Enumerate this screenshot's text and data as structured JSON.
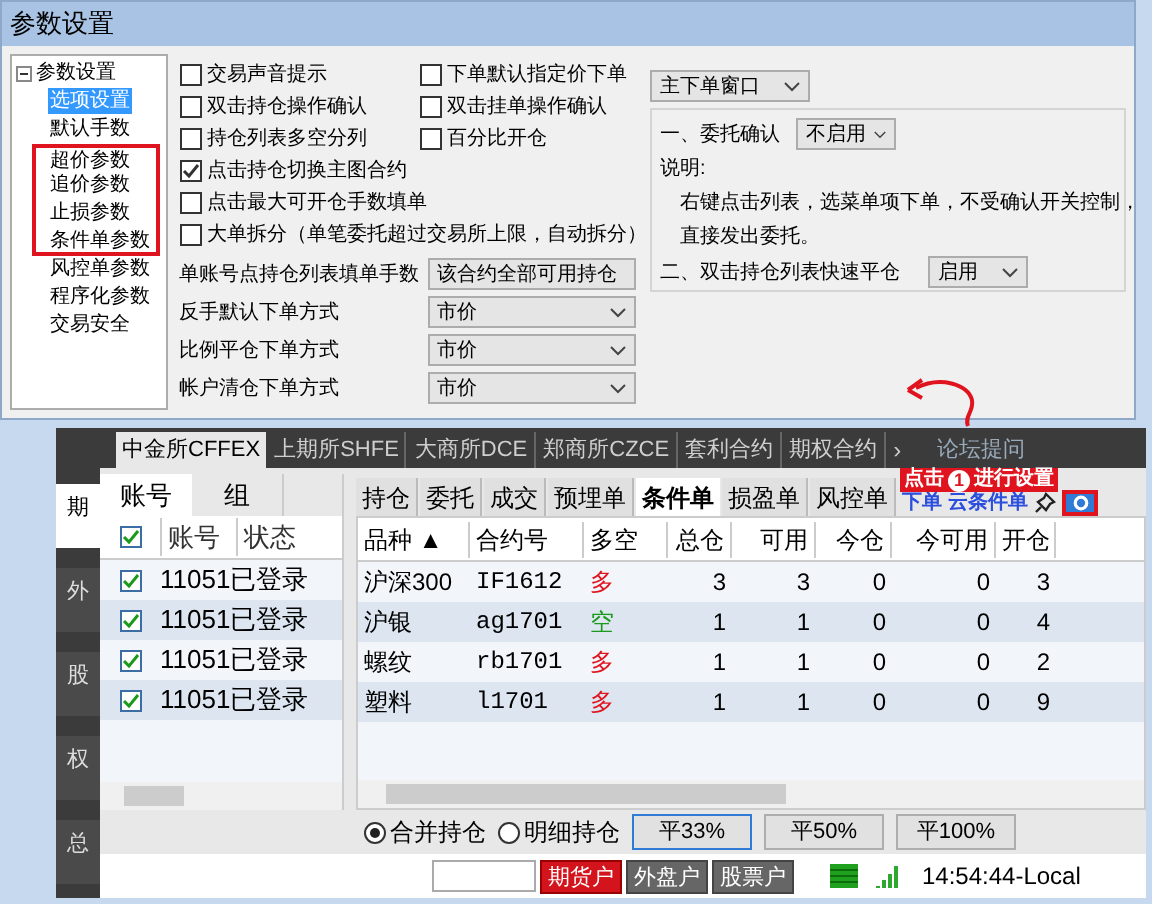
{
  "dialog": {
    "title": "参数设置",
    "tree": [
      {
        "label": "参数设置",
        "expanded": true,
        "selected": false,
        "children": [
          {
            "label": "选项设置",
            "selected": true,
            "highlighted": false
          },
          {
            "label": "默认手数",
            "selected": false,
            "highlighted": false
          },
          {
            "label": "超价参数",
            "selected": false,
            "highlighted": true
          },
          {
            "label": "追价参数",
            "selected": false,
            "highlighted": true
          },
          {
            "label": "止损参数",
            "selected": false,
            "highlighted": true
          },
          {
            "label": "条件单参数",
            "selected": false,
            "highlighted": true
          },
          {
            "label": "风控单参数",
            "selected": false,
            "highlighted": false
          },
          {
            "label": "程序化参数",
            "selected": false,
            "highlighted": false
          },
          {
            "label": "交易安全",
            "selected": false,
            "highlighted": false
          }
        ]
      }
    ],
    "checkbox_rows": [
      [
        {
          "label": "交易声音提示",
          "checked": false
        },
        {
          "label": "下单默认指定价下单",
          "checked": false
        }
      ],
      [
        {
          "label": "双击持仓操作确认",
          "checked": false
        },
        {
          "label": "双击挂单操作确认",
          "checked": false
        }
      ],
      [
        {
          "label": "持仓列表多空分列",
          "checked": false
        },
        {
          "label": "百分比开仓",
          "checked": false
        }
      ],
      [
        {
          "label": "点击持仓切换主图合约",
          "checked": true
        }
      ],
      [
        {
          "label": "点击最大可开仓手数填单",
          "checked": false
        }
      ],
      [
        {
          "label": "大单拆分（单笔委托超过交易所上限，自动拆分）",
          "checked": false
        }
      ]
    ],
    "selects": [
      {
        "label": "单账号点持仓列表填单手数",
        "value": "该合约全部可用持仓"
      },
      {
        "label": "反手默认下单方式",
        "value": "市价"
      },
      {
        "label": "比例平仓下单方式",
        "value": "市价"
      },
      {
        "label": "帐户清仓下单方式",
        "value": "市价"
      }
    ],
    "window_select": "主下单窗口",
    "confirm": {
      "label": "一、委托确认",
      "value": "不启用"
    },
    "note_title": "说明:",
    "note_lines": [
      "右键点击列表，选菜单项下单，不受确认开关控制，",
      "直接发出委托。"
    ],
    "quick_close": {
      "label": "二、双击持仓列表快速平仓",
      "value": "启用"
    }
  },
  "app": {
    "exchange_tabs": [
      {
        "label": "中金所CFFEX",
        "selected": true
      },
      {
        "label": "上期所SHFE",
        "selected": false
      },
      {
        "label": "大商所DCE",
        "selected": false
      },
      {
        "label": "郑商所CZCE",
        "selected": false
      },
      {
        "label": "套利合约",
        "selected": false
      },
      {
        "label": "期权合约",
        "selected": false
      }
    ],
    "more": "›",
    "forum": "论坛提问",
    "side_tabs": [
      {
        "label": "期",
        "selected": true
      },
      {
        "label": "外",
        "selected": false
      },
      {
        "label": "股",
        "selected": false
      },
      {
        "label": "权",
        "selected": false
      },
      {
        "label": "总",
        "selected": false
      }
    ],
    "account_tabs": [
      {
        "label": "账号",
        "selected": true
      },
      {
        "label": "组",
        "selected": false
      }
    ],
    "account_columns": [
      "账号",
      "状态"
    ],
    "account_header_checked": true,
    "accounts": [
      {
        "checked": true,
        "account": "11051",
        "status": "已登录"
      },
      {
        "checked": true,
        "account": "11051",
        "status": "已登录"
      },
      {
        "checked": true,
        "account": "11051",
        "status": "已登录"
      },
      {
        "checked": true,
        "account": "11051",
        "status": "已登录"
      }
    ],
    "order_tabs": [
      {
        "label": "持仓",
        "selected": false
      },
      {
        "label": "委托",
        "selected": false
      },
      {
        "label": "成交",
        "selected": false
      },
      {
        "label": "预埋单",
        "selected": false
      },
      {
        "label": "条件单",
        "selected": true
      },
      {
        "label": "损盈单",
        "selected": false
      },
      {
        "label": "风控单",
        "selected": false
      }
    ],
    "links": [
      "下单",
      "云条件单"
    ],
    "columns": [
      "品种 ▲",
      "合约号",
      "多空",
      "总仓",
      "可用",
      "今仓",
      "今可用",
      "开仓"
    ],
    "rows": [
      {
        "cells": [
          "沪深300",
          "IF1612",
          "多",
          "3",
          "3",
          "0",
          "0",
          "3"
        ],
        "color": "#e0141e"
      },
      {
        "cells": [
          "沪银",
          "ag1701",
          "空",
          "1",
          "1",
          "0",
          "0",
          "4"
        ],
        "color": "#1a9a1a"
      },
      {
        "cells": [
          "螺纹",
          "rb1701",
          "多",
          "1",
          "1",
          "0",
          "0",
          "2"
        ],
        "color": "#e0141e"
      },
      {
        "cells": [
          "塑料",
          "l1701",
          "多",
          "1",
          "1",
          "0",
          "0",
          "9"
        ],
        "color": "#e0141e"
      }
    ],
    "radios": [
      {
        "label": "合并持仓",
        "selected": true
      },
      {
        "label": "明细持仓",
        "selected": false
      }
    ],
    "close_buttons": [
      {
        "label": "平33%",
        "focused": true
      },
      {
        "label": "平50%",
        "focused": false
      },
      {
        "label": "平100%",
        "focused": false
      }
    ],
    "account_types": [
      {
        "label": "期货户",
        "selected": true
      },
      {
        "label": "外盘户",
        "selected": false
      },
      {
        "label": "股票户",
        "selected": false
      }
    ],
    "clock": "14:54:44-Local"
  },
  "annotation": {
    "before": "点击",
    "step": "1",
    "after": "进行设置"
  }
}
